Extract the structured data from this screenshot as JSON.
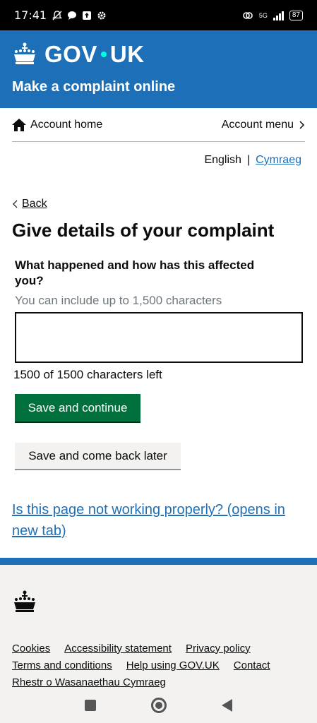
{
  "status_bar": {
    "time": "17:41",
    "network": "5G",
    "battery": "87"
  },
  "header": {
    "logo_prefix": "GOV",
    "logo_suffix": "UK",
    "service_name": "Make a complaint online"
  },
  "account_nav": {
    "home_label": "Account home",
    "menu_label": "Account menu"
  },
  "language": {
    "current": "English",
    "separator": "|",
    "alternate": "Cymraeg"
  },
  "page": {
    "back_label": "Back",
    "title": "Give details of your complaint",
    "question": "What happened and how has this affected you?",
    "hint": "You can include up to 1,500 characters",
    "textarea_value": "",
    "char_count": "1500 of 1500 characters left",
    "save_continue": "Save and continue",
    "save_later": "Save and come back later",
    "problem_link": "Is this page not working properly? (opens in new tab)"
  },
  "footer": {
    "rows": [
      [
        "Cookies",
        "Accessibility statement",
        "Privacy policy"
      ],
      [
        "Terms and conditions",
        "Help using GOV.UK",
        "Contact"
      ],
      [
        "Rhestr o Wasanaethau Cymraeg"
      ]
    ]
  },
  "colors": {
    "brand_blue": "#1d70b8",
    "primary_green": "#00703c",
    "footer_bg": "#f3f2f1",
    "link": "#1d70b8"
  }
}
